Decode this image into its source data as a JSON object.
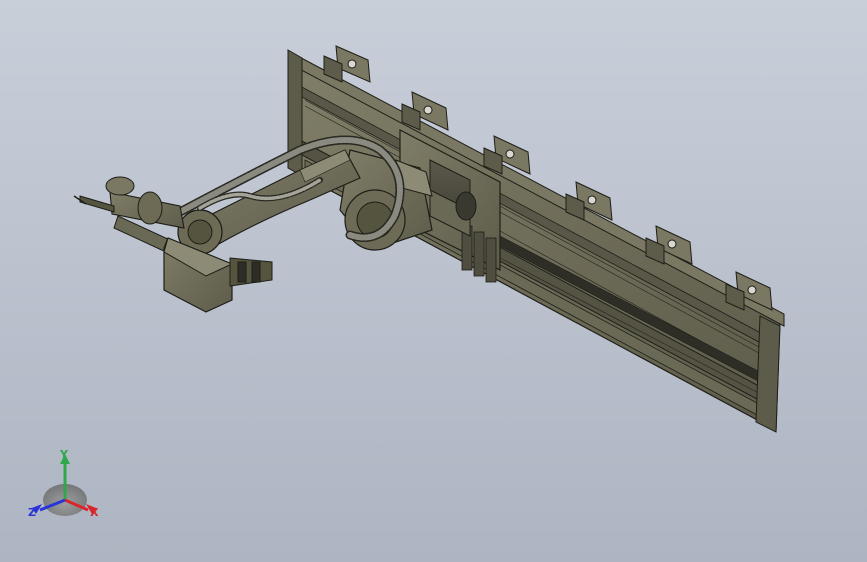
{
  "viewport": {
    "background_top": "#c9cfd9",
    "background_bottom": "#aeb5c2"
  },
  "model": {
    "part_color": "#6f6d58",
    "edge_color": "#1e1e18",
    "hose_color": "#8a8a80"
  },
  "triad": {
    "x_label": "X",
    "y_label": "Y",
    "z_label": "Z",
    "x_color": "#d8262a",
    "y_color": "#2fa84a",
    "z_color": "#2a35d8"
  }
}
